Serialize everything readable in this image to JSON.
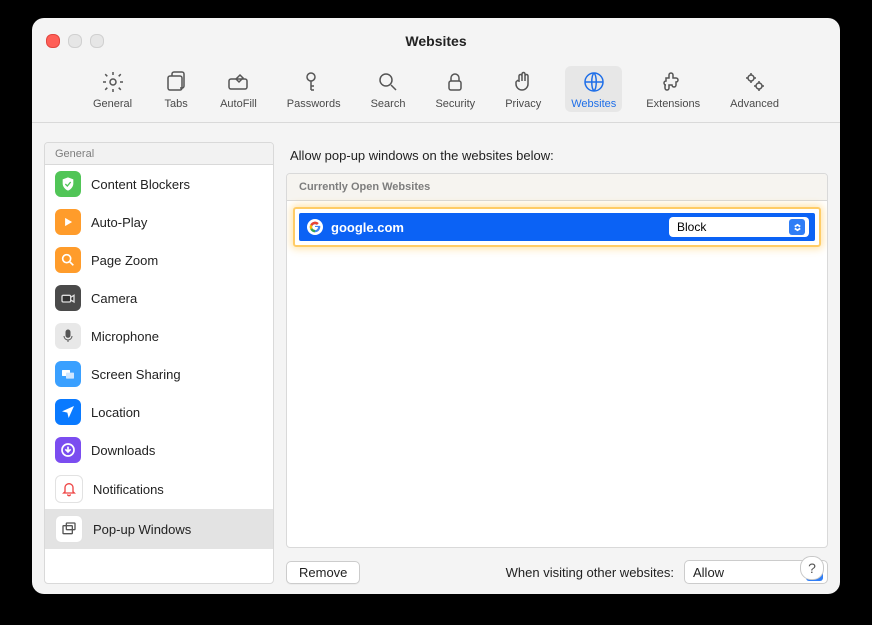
{
  "window": {
    "title": "Websites"
  },
  "toolbar": {
    "items": [
      {
        "id": "general",
        "label": "General"
      },
      {
        "id": "tabs",
        "label": "Tabs"
      },
      {
        "id": "autofill",
        "label": "AutoFill"
      },
      {
        "id": "passwords",
        "label": "Passwords"
      },
      {
        "id": "search",
        "label": "Search"
      },
      {
        "id": "security",
        "label": "Security"
      },
      {
        "id": "privacy",
        "label": "Privacy"
      },
      {
        "id": "websites",
        "label": "Websites",
        "selected": true
      },
      {
        "id": "extensions",
        "label": "Extensions"
      },
      {
        "id": "advanced",
        "label": "Advanced"
      }
    ]
  },
  "sidebar": {
    "header": "General",
    "items": [
      {
        "id": "content-blockers",
        "label": "Content Blockers",
        "icon": "shield-icon",
        "color": "#51c557"
      },
      {
        "id": "auto-play",
        "label": "Auto-Play",
        "icon": "play-icon",
        "color": "#ff9c2b"
      },
      {
        "id": "page-zoom",
        "label": "Page Zoom",
        "icon": "magnifier-icon",
        "color": "#ff9c2b"
      },
      {
        "id": "camera",
        "label": "Camera",
        "icon": "camera-icon",
        "color": "#4a4a4a"
      },
      {
        "id": "microphone",
        "label": "Microphone",
        "icon": "microphone-icon",
        "color": "#d8d8d8"
      },
      {
        "id": "screen-sharing",
        "label": "Screen Sharing",
        "icon": "screens-icon",
        "color": "#3aa0ff"
      },
      {
        "id": "location",
        "label": "Location",
        "icon": "location-icon",
        "color": "#0a7aff"
      },
      {
        "id": "downloads",
        "label": "Downloads",
        "icon": "download-icon",
        "color": "#7b4df0"
      },
      {
        "id": "notifications",
        "label": "Notifications",
        "icon": "bell-icon",
        "color": "#ffffff"
      },
      {
        "id": "popup-windows",
        "label": "Pop-up Windows",
        "icon": "popup-icon",
        "color": "#ffffff",
        "selected": true
      }
    ]
  },
  "main": {
    "title": "Allow pop-up windows on the websites below:",
    "section_header": "Currently Open Websites",
    "sites": [
      {
        "name": "google.com",
        "favicon": "google",
        "policy": "Block"
      }
    ],
    "remove_label": "Remove",
    "default_label": "When visiting other websites:",
    "default_value": "Allow"
  },
  "help": {
    "glyph": "?"
  }
}
